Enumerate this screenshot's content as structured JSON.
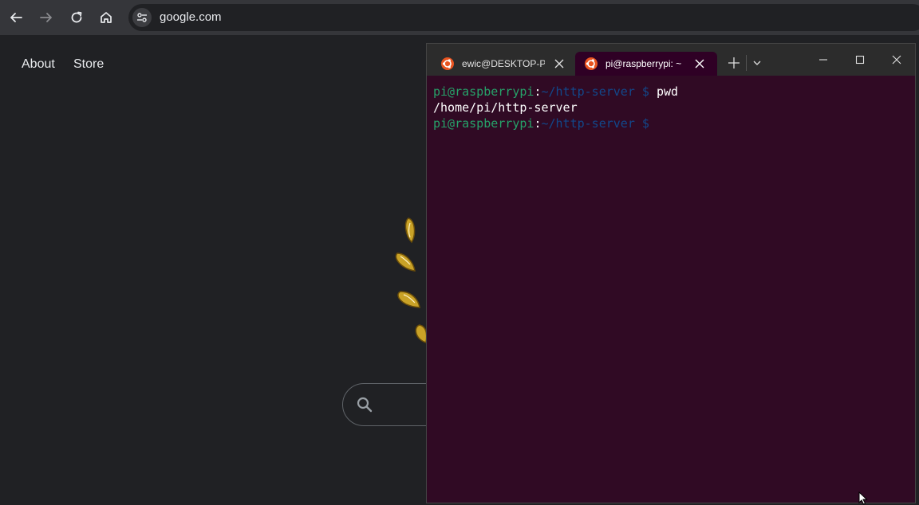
{
  "browser": {
    "url": "google.com",
    "back_icon": "arrow-left-icon",
    "forward_icon": "arrow-right-icon",
    "reload_icon": "reload-icon",
    "home_icon": "home-icon"
  },
  "page": {
    "links": [
      {
        "label": "About"
      },
      {
        "label": "Store"
      }
    ]
  },
  "terminal": {
    "tabs": [
      {
        "label": "ewic@DESKTOP-PI",
        "active": false
      },
      {
        "label": "pi@raspberrypi: ~",
        "active": true
      }
    ],
    "lines": [
      {
        "user": "pi@raspberrypi",
        "colon": ":",
        "path": "~/http-server",
        "dollar": " $ ",
        "cmd": "pwd"
      },
      {
        "output": "/home/pi/http-server"
      },
      {
        "user": "pi@raspberrypi",
        "colon": ":",
        "path": "~/http-server",
        "dollar": " $ ",
        "cmd": ""
      }
    ]
  },
  "colors": {
    "terminal_bg": "#300a24",
    "prompt_user": "#26a269",
    "prompt_path": "#12488b",
    "ubuntu_orange": "#e95420"
  }
}
